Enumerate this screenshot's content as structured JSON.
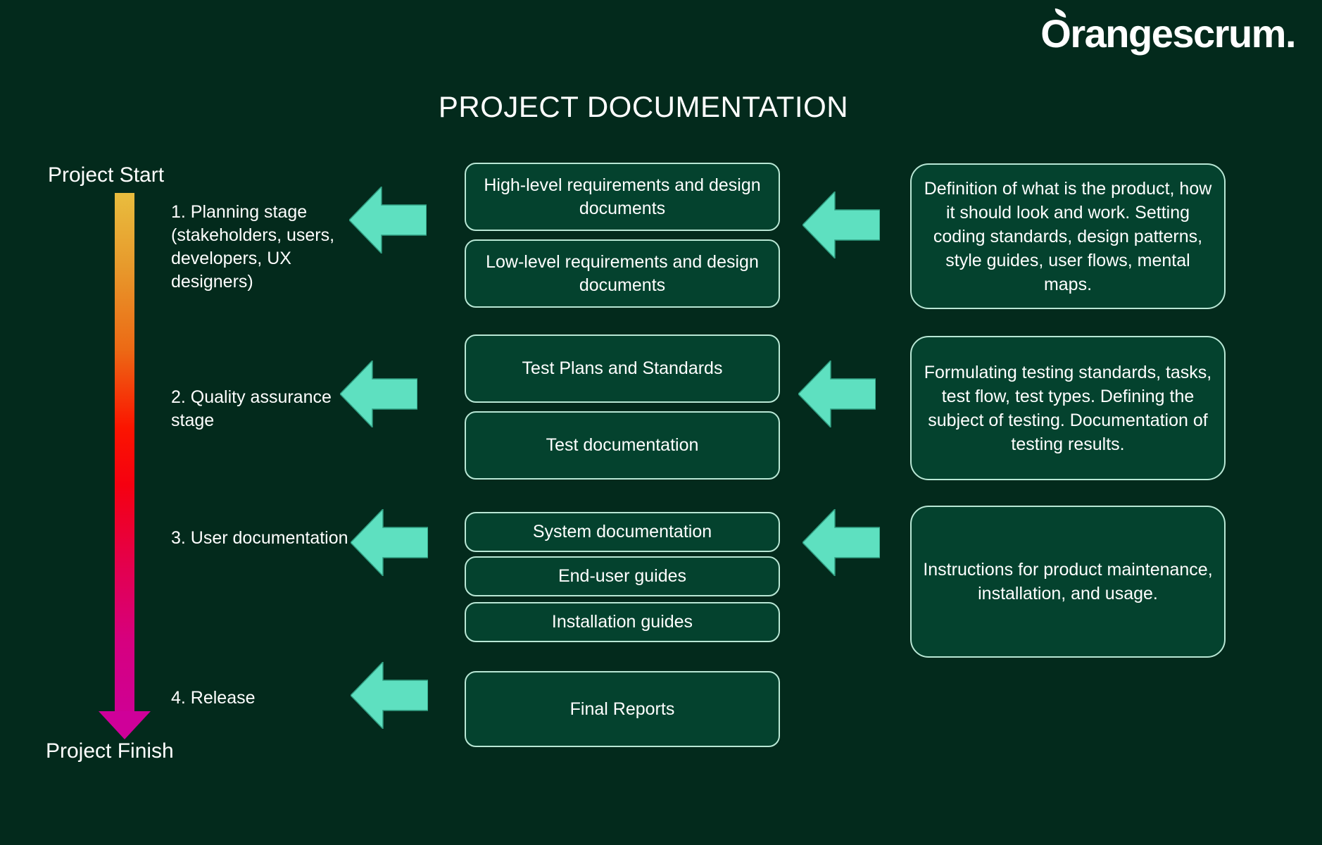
{
  "brand": {
    "logo_text": "rangescrum.",
    "logo_initial": "O",
    "logo_full": "Orangescrum.",
    "logo_color": "#ffffff"
  },
  "page": {
    "title": "PROJECT DOCUMENTATION",
    "background_color": "#032a1c",
    "box_fill_color": "#04422e",
    "box_border_color": "#b9e7d5",
    "arrow_color": "#5ee0c0",
    "text_color": "#ffffff"
  },
  "timeline": {
    "start_label": "Project Start",
    "finish_label": "Project Finish",
    "gradient_stops": [
      "#e9bd3e",
      "#e79a2c",
      "#ec6a15",
      "#fb1500",
      "#e3004f",
      "#cf0094"
    ],
    "arrowhead_color": "#cf0099",
    "stages": [
      {
        "label": "1. Planning stage (stakeholders, users, developers, UX designers)"
      },
      {
        "label": "2. Quality assurance stage"
      },
      {
        "label": "3. User documentation"
      },
      {
        "label": "4. Release"
      }
    ]
  },
  "documents": {
    "stage1": [
      "High-level requirements and design documents",
      "Low-level requirements and design documents"
    ],
    "stage2": [
      "Test Plans and Standards",
      "Test documentation"
    ],
    "stage3": [
      "System documentation",
      "End-user guides",
      "Installation guides"
    ],
    "stage4": [
      "Final Reports"
    ]
  },
  "descriptions": {
    "stage1": "Definition of what is the product, how it should look and work. Setting coding standards, design patterns, style guides, user flows, mental maps.",
    "stage2": "Formulating testing standards, tasks, test flow, test types. Defining the subject of testing. Documentation of testing results.",
    "stage3": "Instructions for product maintenance, installation, and usage."
  },
  "icons": {
    "arrow_left": "arrow-left-icon",
    "arrow_down": "arrow-down-icon",
    "leaf": "leaf-icon"
  }
}
